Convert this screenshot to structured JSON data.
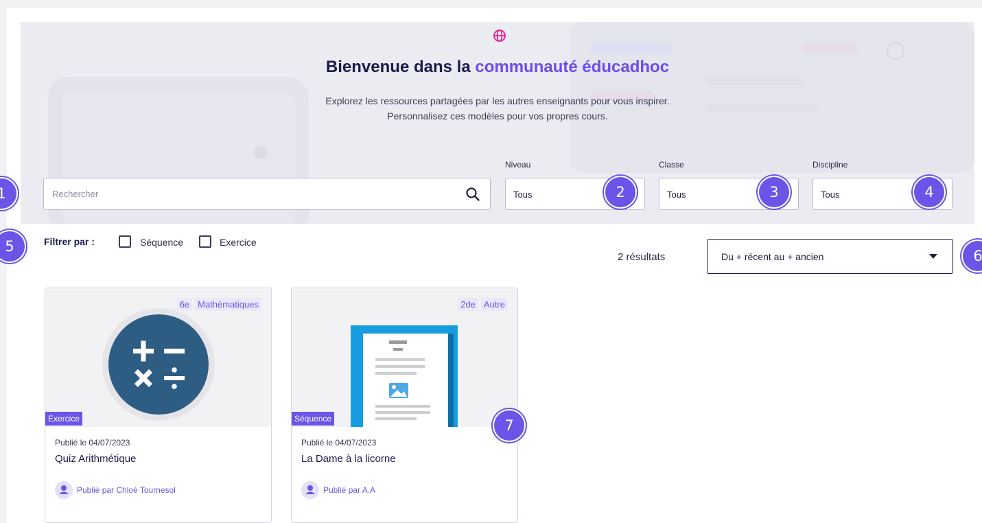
{
  "hero": {
    "title_part1": "Bienvenue dans la",
    "title_accent": "communauté éducadhoc",
    "subtitle_line1": "Explorez les ressources partagées par les autres enseignants pour vous inspirer.",
    "subtitle_line2": "Personnalisez ces modèles pour vos propres cours."
  },
  "search": {
    "placeholder": "Rechercher"
  },
  "filters": {
    "niveau": {
      "label": "Niveau",
      "value": "Tous"
    },
    "classe": {
      "label": "Classe",
      "value": "Tous"
    },
    "discipline": {
      "label": "Discipline",
      "value": "Tous"
    }
  },
  "filter_by": {
    "label": "Filtrer par :",
    "options": [
      {
        "label": "Séquence",
        "checked": false
      },
      {
        "label": "Exercice",
        "checked": false
      }
    ]
  },
  "results": {
    "count_label": "2 résultats"
  },
  "sort": {
    "value": "Du + récent au + ancien"
  },
  "cards": [
    {
      "tags": [
        "6e",
        "Mathématiques"
      ],
      "type": "Exercice",
      "published": "Publié le 04/07/2023",
      "title": "Quiz Arithmétique",
      "author": "Publié par Chloé Tournesol",
      "icon": "math-operations-icon"
    },
    {
      "tags": [
        "2de",
        "Autre"
      ],
      "type": "Séquence",
      "published": "Publié le 04/07/2023",
      "title": "La Dame à la licorne",
      "author": "Publié par A.A",
      "icon": "document-icon"
    }
  ],
  "callouts": [
    "1",
    "2",
    "3",
    "4",
    "5",
    "6",
    "7"
  ],
  "colors": {
    "accent": "#6b54e8",
    "navy": "#1b1b4d",
    "hero_bg": "#ebebf2",
    "math_circle": "#2e5d84",
    "doc_blue": "#1a9ce0",
    "globe": "#e0218a"
  }
}
